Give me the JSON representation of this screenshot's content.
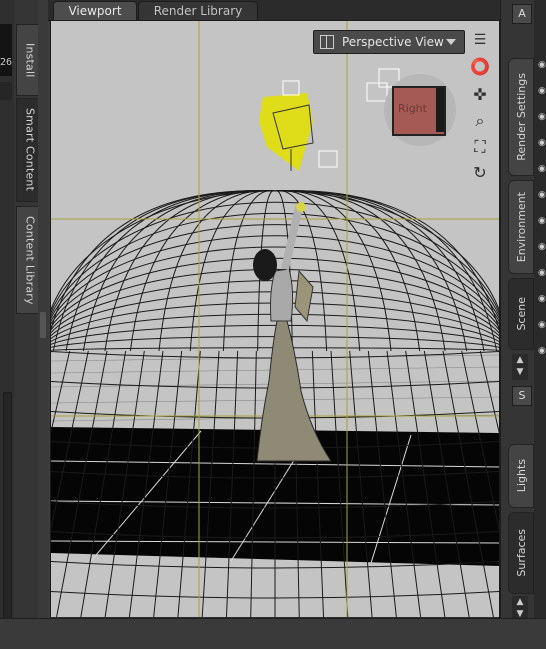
{
  "left_panel": {
    "value": "26",
    "tabs": [
      {
        "label": "Install"
      },
      {
        "label": "Smart Content",
        "active": true
      },
      {
        "label": "Content Library"
      }
    ]
  },
  "top_tabs": [
    {
      "label": "Viewport",
      "active": true
    },
    {
      "label": "Render Library",
      "active": false
    }
  ],
  "viewport": {
    "camera_dropdown": {
      "label": "Perspective View"
    },
    "nav_icons": [
      "orbit-icon",
      "pan-icon",
      "zoom-icon",
      "frame-icon",
      "reset-icon"
    ],
    "view_cube": {
      "label": "Right",
      "face_color": "#a55a56"
    },
    "guide_color": "#a8a23a",
    "selection_color": "#e0dd10"
  },
  "right_panel": {
    "tabs_upper": [
      {
        "label": "Render Settings"
      },
      {
        "label": "Environment"
      },
      {
        "label": "Scene",
        "active": true
      }
    ],
    "tabs_lower": [
      {
        "label": "Lights"
      },
      {
        "label": "Surfaces",
        "active": true
      }
    ],
    "top_letter": "A",
    "lower_letter": "S"
  }
}
